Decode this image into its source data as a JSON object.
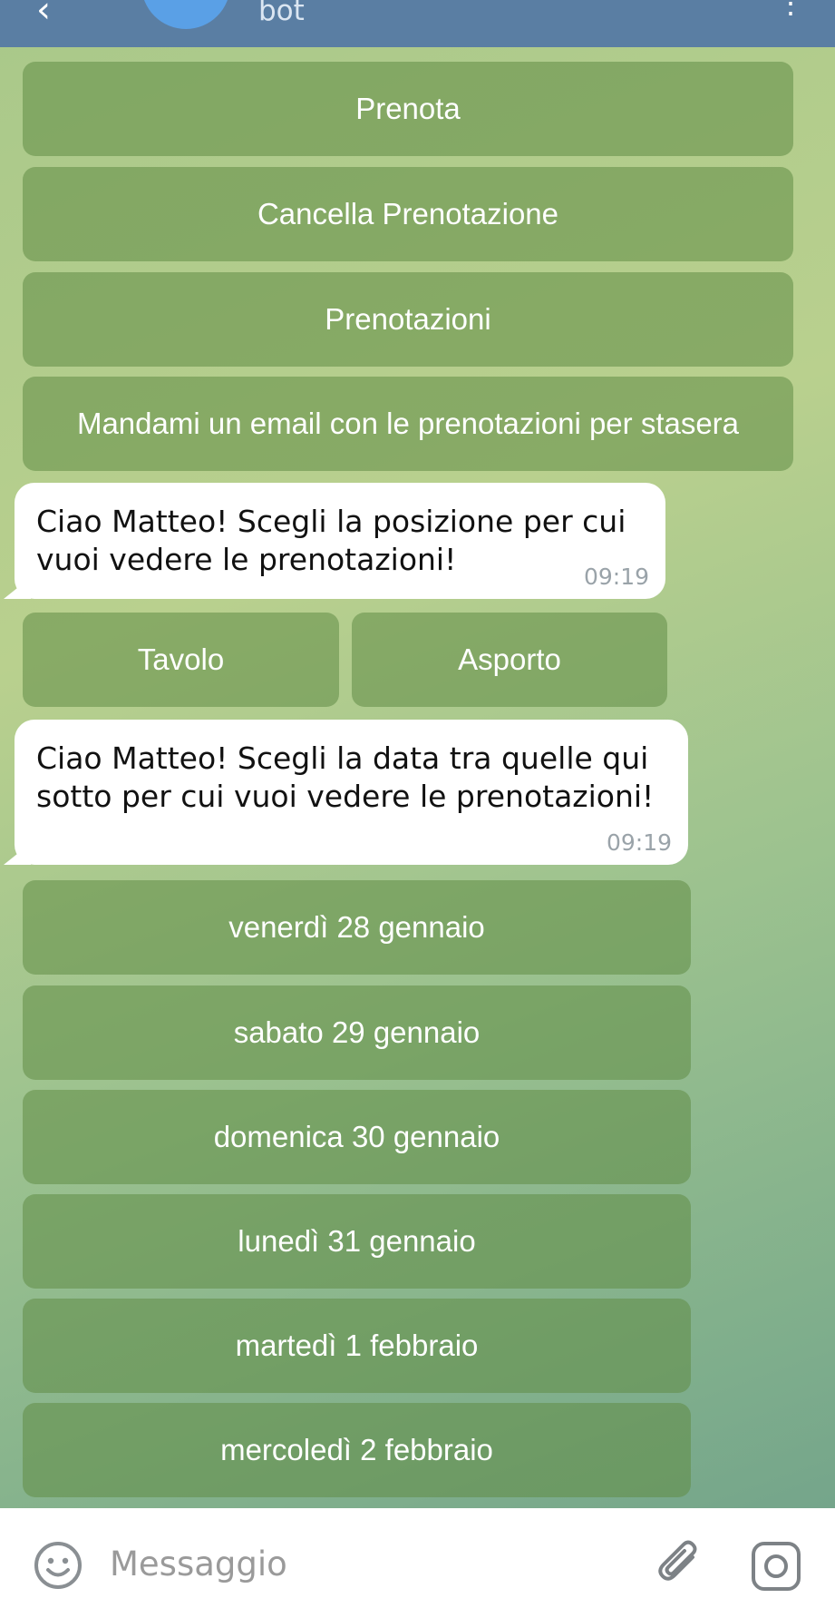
{
  "header": {
    "subtitle": "bot",
    "back_icon": "back-arrow-icon",
    "menu_icon": "more-vert-icon",
    "colors": {
      "bar": "#5a7ea3",
      "avatar": "#5aa0e6"
    }
  },
  "main_menu": {
    "buttons": [
      {
        "label": "Prenota"
      },
      {
        "label": "Cancella Prenotazione"
      },
      {
        "label": "Prenotazioni"
      },
      {
        "label": "Mandami un email con le prenotazioni per stasera"
      }
    ]
  },
  "messages": [
    {
      "lines": [
        "Ciao Matteo! Scegli la posizione per cui",
        "vuoi vedere le prenotazioni!"
      ],
      "time": "09:19",
      "buttons": [
        {
          "label": "Tavolo"
        },
        {
          "label": "Asporto"
        }
      ]
    },
    {
      "lines": [
        "Ciao Matteo! Scegli la data tra quelle qui",
        "sotto per cui vuoi vedere le prenotazioni!"
      ],
      "time": "09:19",
      "buttons": [
        {
          "label": "venerdì 28 gennaio"
        },
        {
          "label": "sabato 29 gennaio"
        },
        {
          "label": "domenica 30 gennaio"
        },
        {
          "label": "lunedì 31 gennaio"
        },
        {
          "label": "martedì 1 febbraio"
        },
        {
          "label": "mercoledì 2 febbraio"
        }
      ]
    }
  ],
  "input": {
    "placeholder": "Messaggio",
    "emoji_icon": "emoji-icon",
    "attach_icon": "paperclip-icon",
    "camera_icon": "camera-icon"
  }
}
